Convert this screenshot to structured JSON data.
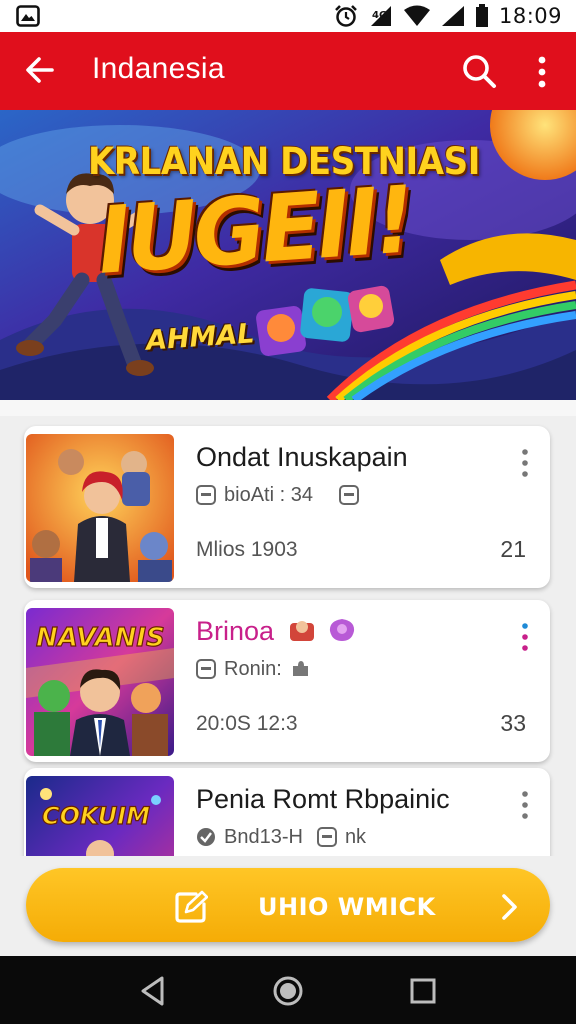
{
  "status_bar": {
    "time": "18:09",
    "icons": [
      "gallery-icon",
      "alarm-icon",
      "mobile-signal-icon",
      "wifi-icon",
      "signal-icon",
      "battery-icon"
    ]
  },
  "app_bar": {
    "title": "Indanesia",
    "icons": [
      "back-arrow-icon",
      "search-icon",
      "more-vert-icon"
    ],
    "background": "#e00f1c"
  },
  "banner": {
    "line1": "KRLANAN DESTNIASI",
    "line2": "IUGEII!",
    "line3": "AHMAL"
  },
  "list": [
    {
      "title": "Ondat Inuskapain",
      "meta": "bioAti : 34",
      "foot": "Mlios 1903",
      "count": "21",
      "thumb_text": ""
    },
    {
      "title": "Brinoa",
      "meta": "Ronin:",
      "foot": "20:0S 12:3",
      "count": "33",
      "thumb_text": "NAVANIS"
    },
    {
      "title": "Penia Romt Rbpainic",
      "meta": "Bnd13-H",
      "meta2": "nk",
      "foot": "",
      "count": "",
      "thumb_text": "COKUIM"
    }
  ],
  "cta": {
    "label": "UHIO WMICK",
    "color": "#f8b50f"
  },
  "nav": {
    "icons": [
      "nav-back-icon",
      "nav-home-icon",
      "nav-recents-icon"
    ]
  }
}
